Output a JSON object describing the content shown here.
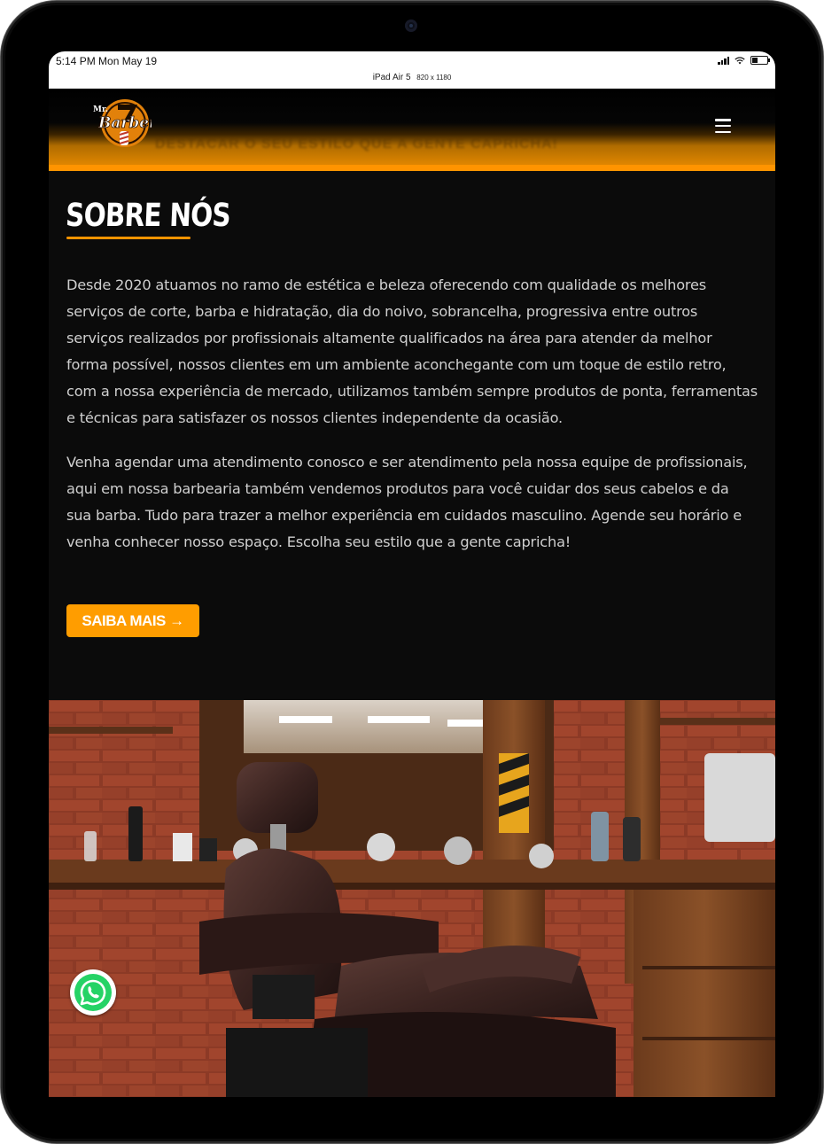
{
  "status_bar": {
    "time": "5:14 PM  Mon May 19",
    "device_name": "iPad Air 5",
    "device_dims": "820 x 1180"
  },
  "header": {
    "logo_alt": "Mr. Barber",
    "logo_small_text": "Mr.",
    "logo_text": "Barber",
    "promo_text": "DESTACAR O SEU ESTILO QUE A GENTE CAPRICHA!",
    "menu_icon": "hamburger-menu-icon"
  },
  "about": {
    "title": "SOBRE NÓS",
    "paragraph_1": "Desde 2020 atuamos no ramo de estética e beleza oferecendo com qualidade os melhores serviços de corte, barba e hidratação, dia do noivo, sobrancelha, progressiva entre outros serviços realizados por profissionais altamente qualificados na área para atender da melhor forma possível, nossos clientes em um ambiente aconchegante com um toque de estilo retro, com a nossa experiência de mercado, utilizamos também sempre produtos de ponta, ferramentas e técnicas para satisfazer os nossos clientes independente da ocasião.",
    "paragraph_2": "Venha agendar uma atendimento conosco e ser atendimento pela nossa equipe de profissionais, aqui em nossa barbearia também vendemos produtos para você cuidar dos seus cabelos e da sua barba. Tudo para trazer a melhor experiência em cuidados masculino. Agende seu horário e venha conhecer nosso espaço. Escolha seu estilo que a gente capricha!",
    "cta_label": "SAIBA MAIS →"
  },
  "photo": {
    "alt": "Barber chair in a barbershop with brick wall"
  },
  "whatsapp": {
    "icon": "whatsapp-icon"
  },
  "colors": {
    "accent": "#ff9400",
    "background": "#0b0b0b",
    "text": "#cfcfcf",
    "whatsapp_green": "#25d366"
  }
}
